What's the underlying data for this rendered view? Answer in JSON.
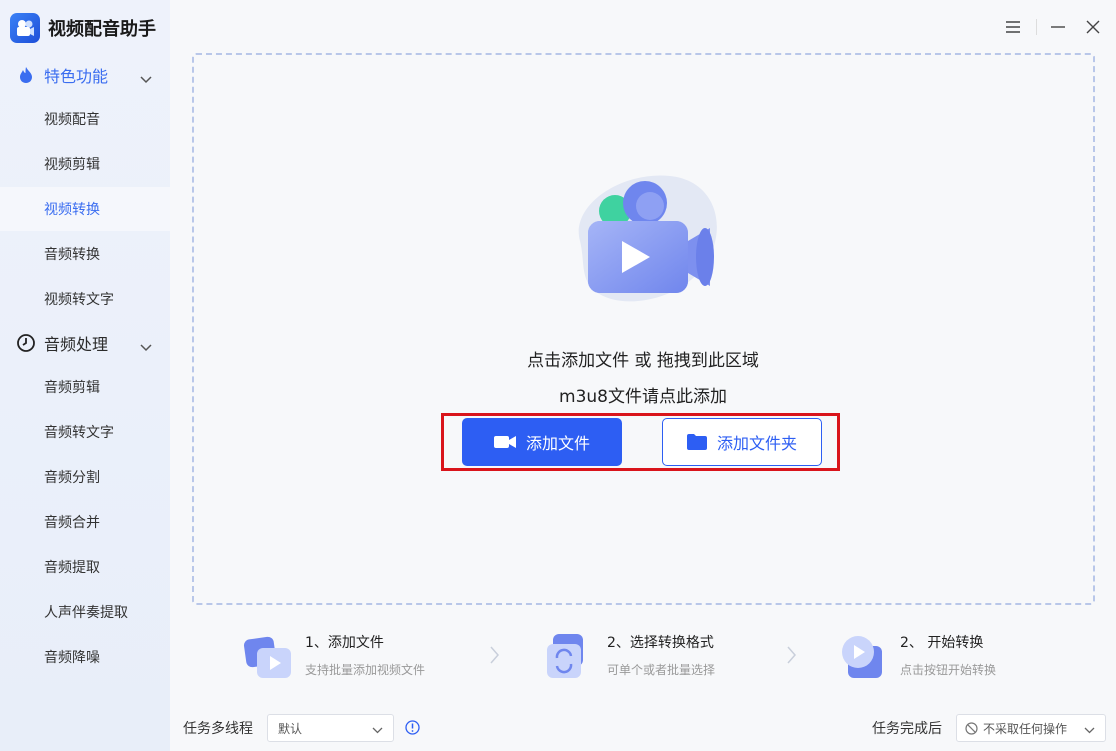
{
  "app": {
    "title": "视频配音助手"
  },
  "sidebar": {
    "sections": [
      {
        "label": "特色功能",
        "icon": "flame-icon"
      },
      {
        "label": "音频处理",
        "icon": "clock-icon"
      }
    ],
    "items": [
      {
        "label": "视频配音"
      },
      {
        "label": "视频剪辑"
      },
      {
        "label": "视频转换",
        "active": true
      },
      {
        "label": "音频转换"
      },
      {
        "label": "视频转文字"
      },
      {
        "label": "音频剪辑"
      },
      {
        "label": "音频转文字"
      },
      {
        "label": "音频分割"
      },
      {
        "label": "音频合并"
      },
      {
        "label": "音频提取"
      },
      {
        "label": "人声伴奏提取"
      },
      {
        "label": "音频降噪"
      }
    ]
  },
  "dropzone": {
    "line1": "点击添加文件 或 拖拽到此区域",
    "line2": "m3u8文件请点此添加",
    "add_file": "添加文件",
    "add_folder": "添加文件夹"
  },
  "steps": [
    {
      "title": "1、添加文件",
      "desc": "支持批量添加视频文件"
    },
    {
      "title": "2、选择转换格式",
      "desc": "可单个或者批量选择"
    },
    {
      "title": "2、 开始转换",
      "desc": "点击按钮开始转换"
    }
  ],
  "footer": {
    "threads_label": "任务多线程",
    "threads_value": "默认",
    "after_label": "任务完成后",
    "after_value": "不采取任何操作"
  },
  "colors": {
    "accent": "#2d5ef3",
    "highlight": "#d9141b"
  }
}
